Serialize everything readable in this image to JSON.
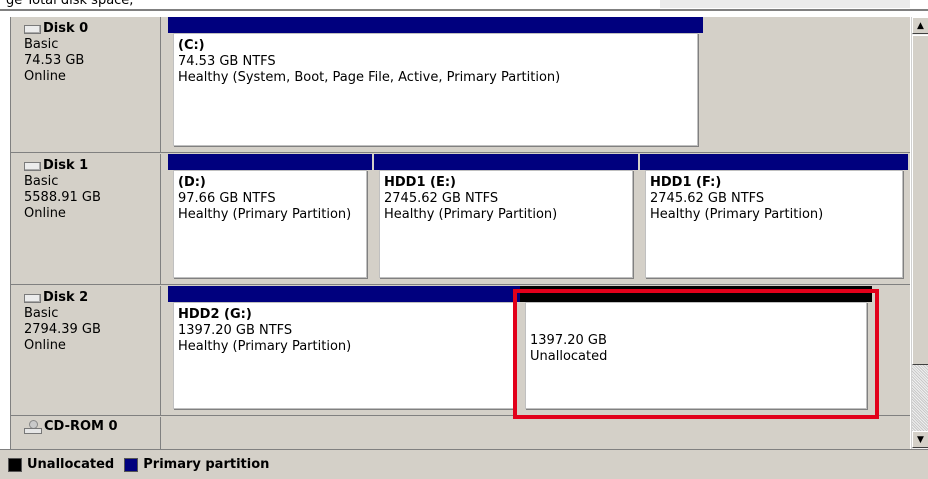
{
  "colors": {
    "primary_partition": "#00007e",
    "unallocated": "#000000",
    "selection_highlight": "#e2001a"
  },
  "top_fragment": "ge  Total disk space,",
  "disks": [
    {
      "name": "Disk 0",
      "icon": "disk-icon",
      "type": "Basic",
      "size": "74.53 GB",
      "status": "Online",
      "partitions": [
        {
          "label": "(C:)",
          "detail": "74.53 GB NTFS",
          "health": "Healthy (System, Boot, Page File, Active, Primary Partition)",
          "kind": "primary"
        }
      ]
    },
    {
      "name": "Disk 1",
      "icon": "disk-icon",
      "type": "Basic",
      "size": "5588.91 GB",
      "status": "Online",
      "partitions": [
        {
          "label": "(D:)",
          "detail": "97.66 GB NTFS",
          "health": "Healthy (Primary Partition)",
          "kind": "primary"
        },
        {
          "label": "HDD1  (E:)",
          "detail": "2745.62 GB NTFS",
          "health": "Healthy (Primary Partition)",
          "kind": "primary"
        },
        {
          "label": "HDD1  (F:)",
          "detail": "2745.62 GB NTFS",
          "health": "Healthy (Primary Partition)",
          "kind": "primary"
        }
      ]
    },
    {
      "name": "Disk 2",
      "icon": "disk-icon",
      "type": "Basic",
      "size": "2794.39 GB",
      "status": "Online",
      "partitions": [
        {
          "label": "HDD2  (G:)",
          "detail": "1397.20 GB NTFS",
          "health": "Healthy (Primary Partition)",
          "kind": "primary"
        },
        {
          "label": "",
          "detail": "1397.20 GB",
          "health": "Unallocated",
          "kind": "unallocated"
        }
      ]
    },
    {
      "name": "CD-ROM 0",
      "icon": "cd-rom-icon"
    }
  ],
  "legend": [
    {
      "label": "Unallocated",
      "kind": "unallocated"
    },
    {
      "label": "Primary partition",
      "kind": "primary"
    }
  ],
  "scrollbar": {
    "up_icon": "scroll-up-icon",
    "down_icon": "scroll-down-icon"
  }
}
